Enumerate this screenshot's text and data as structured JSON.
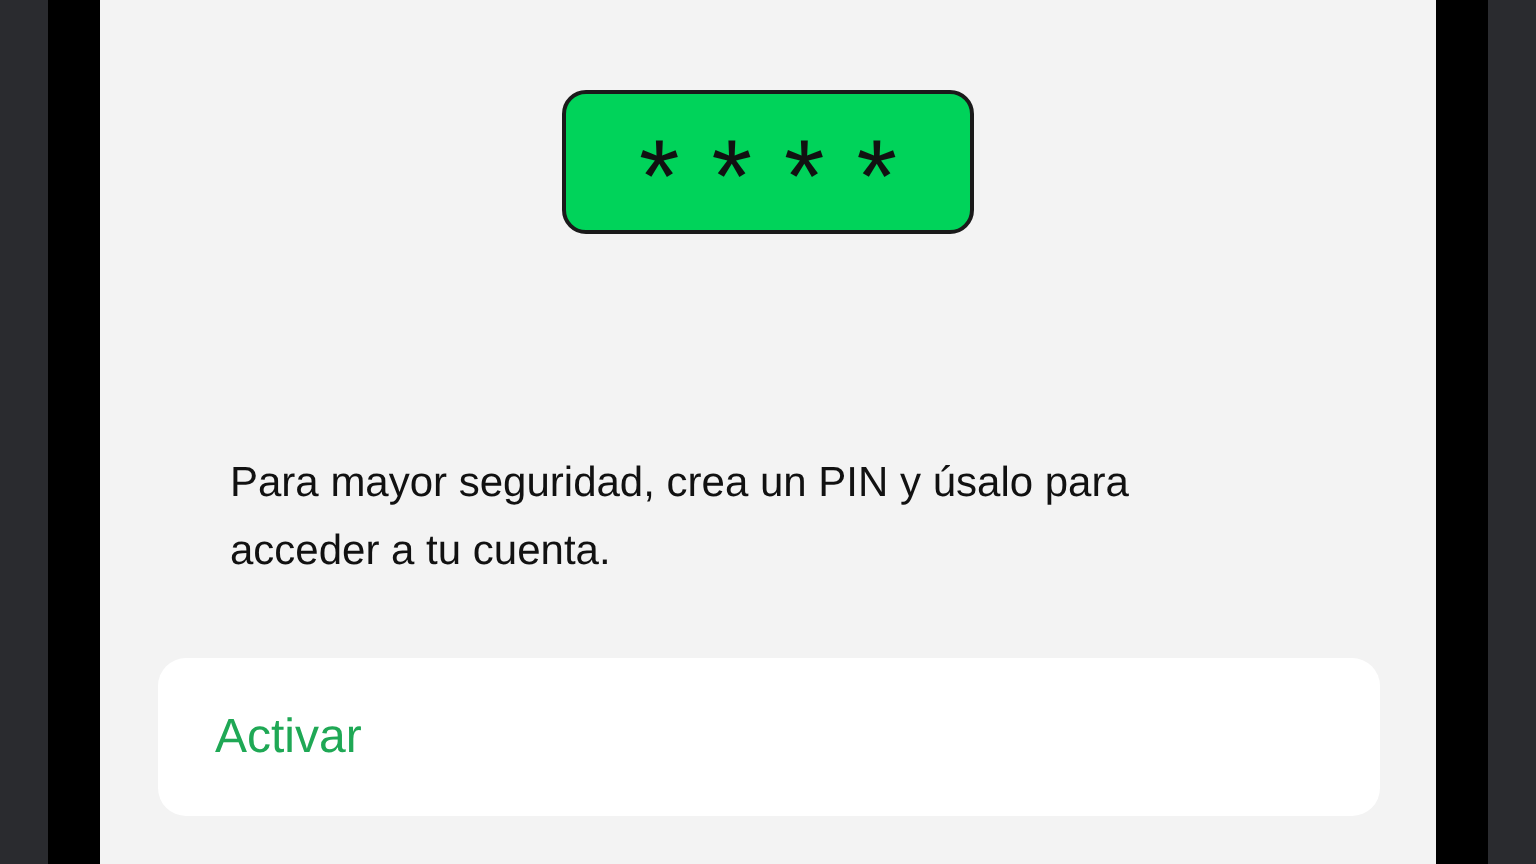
{
  "pin_badge": {
    "text": "****"
  },
  "description": "Para mayor seguridad, crea un PIN y úsalo para acceder a tu cuenta.",
  "action": {
    "label": "Activar"
  }
}
